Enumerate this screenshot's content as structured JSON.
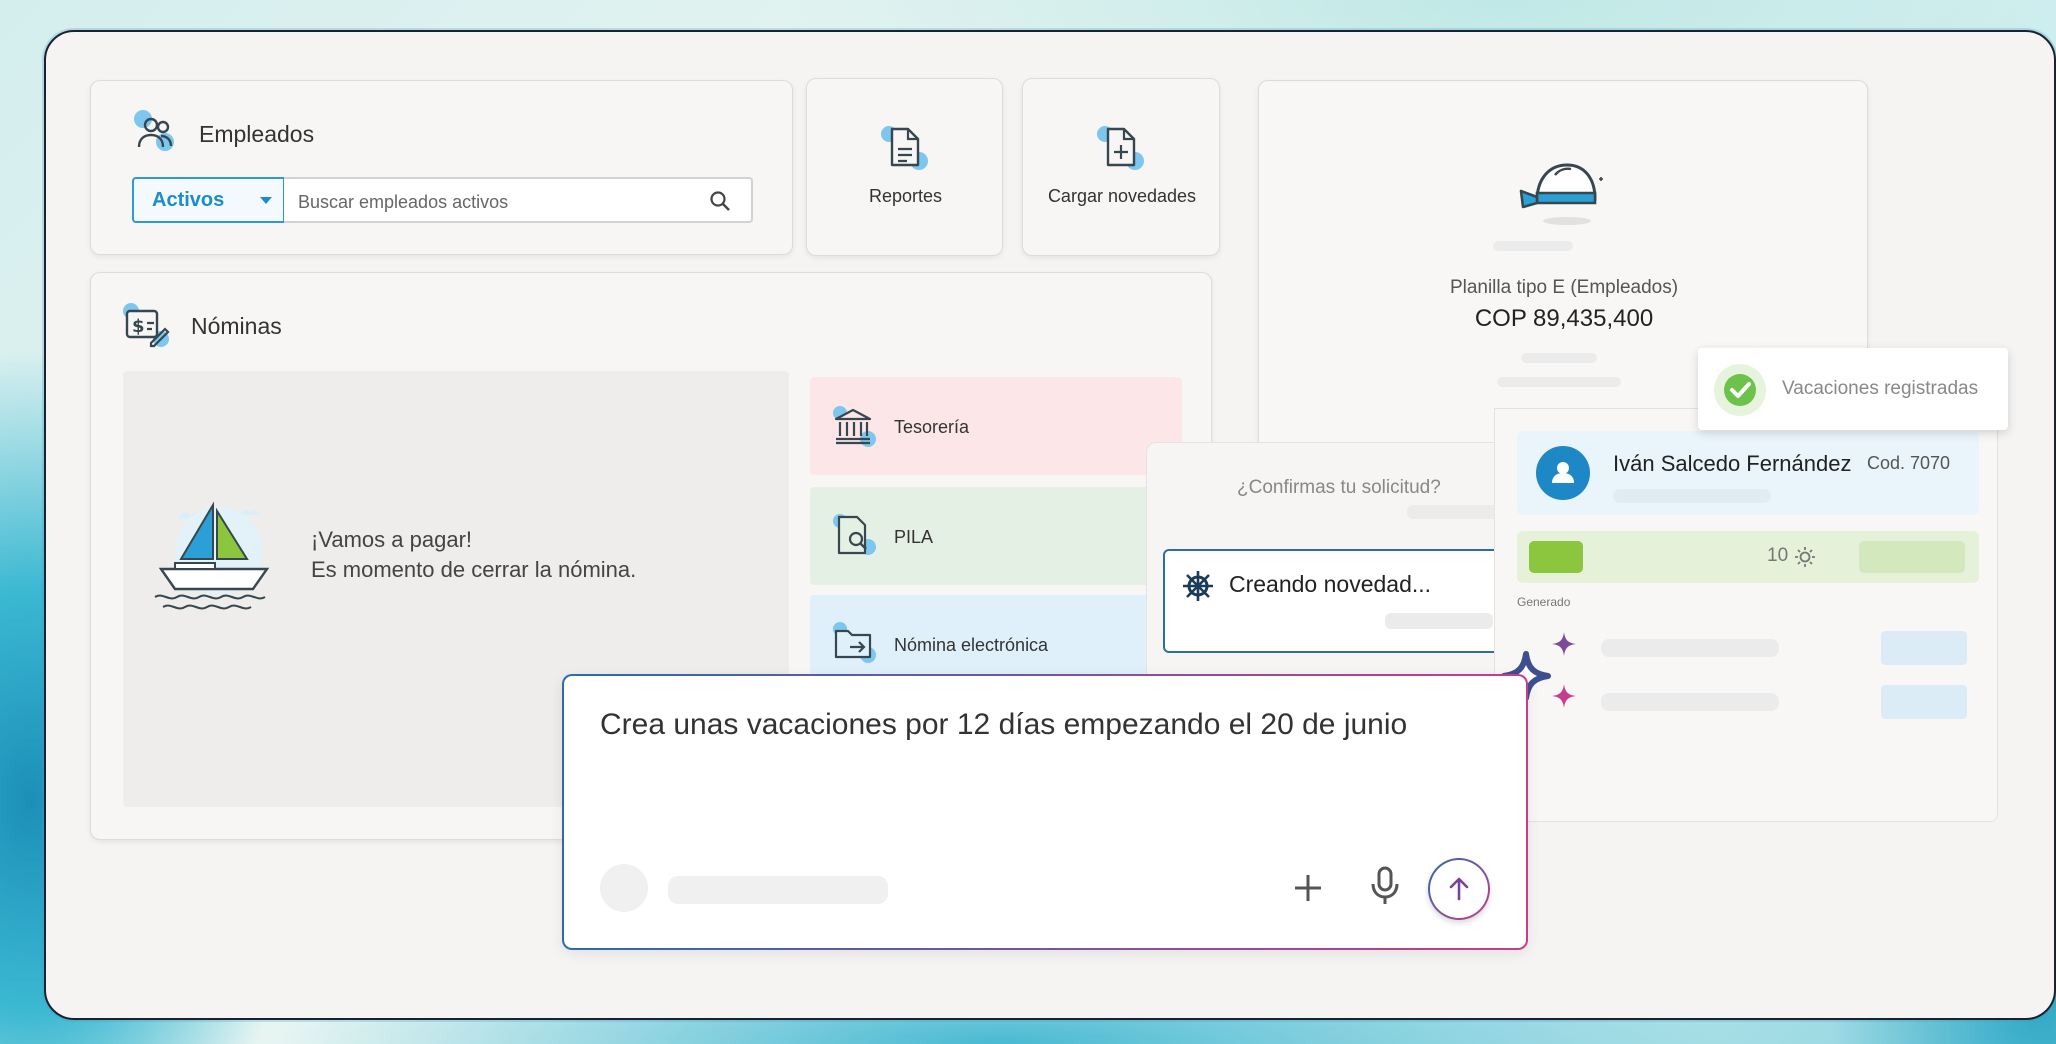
{
  "employees": {
    "title": "Empleados",
    "filter_value": "Activos",
    "search_placeholder": "Buscar empleados activos"
  },
  "quick_actions": {
    "reports_label": "Reportes",
    "upload_label": "Cargar novedades"
  },
  "payroll": {
    "title": "Nóminas",
    "banner_line1": "¡Vamos a pagar!",
    "banner_line2": "Es momento de cerrar la nómina.",
    "items": [
      {
        "label": "Tesorería",
        "color": "#fde6e8"
      },
      {
        "label": "PILA",
        "color": "#e4f0e3"
      },
      {
        "label": "Nómina electrónica",
        "color": "#dff0fb"
      }
    ]
  },
  "planilla": {
    "title": "Planilla tipo E (Empleados)",
    "amount": "COP 89,435,400"
  },
  "toast": {
    "message": "Vacaciones registradas",
    "color": "#6cc24a"
  },
  "confirm": {
    "question": "¿Confirmas tu solicitud?",
    "status": "Creando novedad..."
  },
  "employee_card": {
    "name": "Iván Salcedo Fernández",
    "code": "Cod. 7070",
    "days": "10",
    "generated_label": "Generado"
  },
  "prompt": {
    "text": "Crea unas vacaciones por 12 días empezando el 20 de junio",
    "accent": "#c93b8e"
  },
  "icons": [
    "employees-icon",
    "reports-icon",
    "upload-icon",
    "payroll-icon",
    "bank-icon",
    "pila-icon",
    "folder-icon",
    "sailboat-icon",
    "helmet-icon",
    "check-icon",
    "helm-icon",
    "user-icon",
    "sun-icon",
    "sparkle-icon",
    "plus-icon",
    "mic-icon",
    "arrow-up-icon",
    "search-icon",
    "caret-down-icon"
  ]
}
